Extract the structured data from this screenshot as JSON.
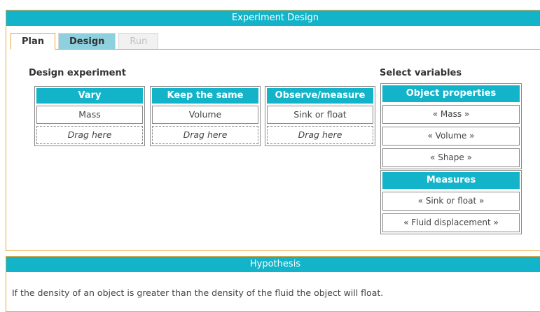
{
  "experiment_panel": {
    "title": "Experiment Design",
    "tabs": [
      {
        "label": "Plan",
        "state": "active"
      },
      {
        "label": "Design",
        "state": "enabled"
      },
      {
        "label": "Run",
        "state": "disabled"
      }
    ]
  },
  "design": {
    "title": "Design experiment",
    "columns": [
      {
        "header": "Vary",
        "value": "Mass",
        "drop": "Drag here"
      },
      {
        "header": "Keep the same",
        "value": "Volume",
        "drop": "Drag here"
      },
      {
        "header": "Observe/measure",
        "value": "Sink or float",
        "drop": "Drag here"
      }
    ]
  },
  "variables": {
    "title": "Select variables",
    "object_properties": {
      "header": "Object properties",
      "items": [
        "« Mass »",
        "« Volume »",
        "« Shape »"
      ]
    },
    "measures": {
      "header": "Measures",
      "items": [
        "« Sink or float »",
        "« Fluid displacement »"
      ]
    }
  },
  "hypothesis": {
    "title": "Hypothesis",
    "text": "If the density of an object is greater than the density of the fluid the object will float."
  },
  "colors": {
    "header_teal": "#13b3c9",
    "panel_border_orange": "#e8a63a",
    "tab_design_bg": "#8fd0de"
  }
}
